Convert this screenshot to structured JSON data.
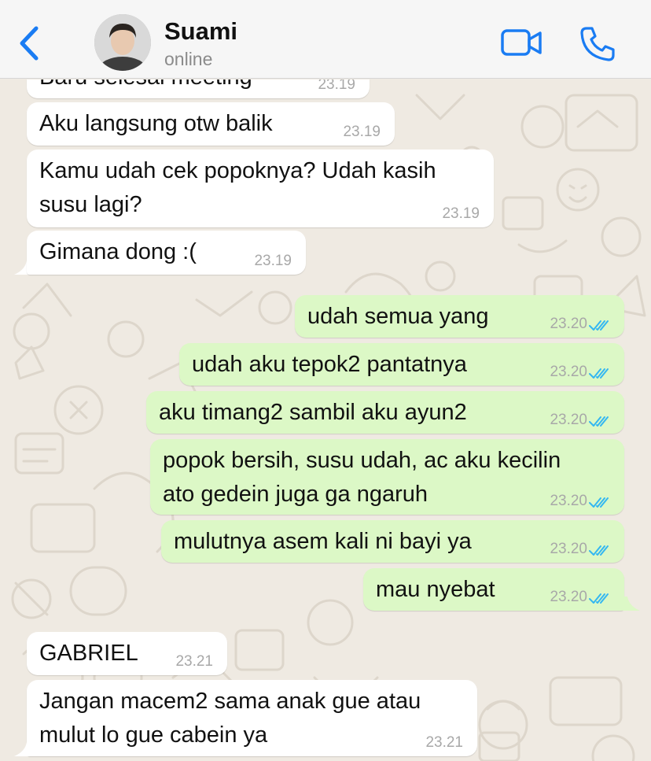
{
  "header": {
    "contact_name": "Suami",
    "status": "online",
    "icons": {
      "back": "chevron-left-icon",
      "video": "video-camera-icon",
      "call": "phone-icon"
    }
  },
  "colors": {
    "accent": "#1a7cf3",
    "incoming_bubble": "#ffffff",
    "outgoing_bubble": "#dcf8c6",
    "chat_background": "#efeae2",
    "read_ticks": "#34b7f1"
  },
  "messages": [
    {
      "direction": "in",
      "text": "Baru selesai meeting",
      "time": "23.19"
    },
    {
      "direction": "in",
      "text": "Aku langsung otw balik",
      "time": "23.19"
    },
    {
      "direction": "in",
      "text": "Kamu udah cek popoknya? Udah kasih",
      "text2": "susu lagi?",
      "time": "23.19"
    },
    {
      "direction": "in",
      "text": "Gimana dong :(",
      "time": "23.19"
    },
    {
      "direction": "out",
      "text": "udah semua yang",
      "time": "23.20",
      "status": "read"
    },
    {
      "direction": "out",
      "text": "udah aku tepok2 pantatnya",
      "time": "23.20",
      "status": "read"
    },
    {
      "direction": "out",
      "text": "aku timang2 sambil aku ayun2",
      "time": "23.20",
      "status": "read"
    },
    {
      "direction": "out",
      "text": "popok bersih, susu udah, ac aku kecilin",
      "text2": "ato gedein juga ga ngaruh",
      "time": "23.20",
      "status": "read"
    },
    {
      "direction": "out",
      "text": "mulutnya asem kali ni bayi ya",
      "time": "23.20",
      "status": "read"
    },
    {
      "direction": "out",
      "text": "mau nyebat",
      "time": "23.20",
      "status": "read"
    },
    {
      "direction": "in",
      "text": "GABRIEL",
      "time": "23.21"
    },
    {
      "direction": "in",
      "text": "Jangan macem2 sama anak gue atau",
      "text2": "mulut lo gue cabein ya",
      "time": "23.21"
    }
  ]
}
